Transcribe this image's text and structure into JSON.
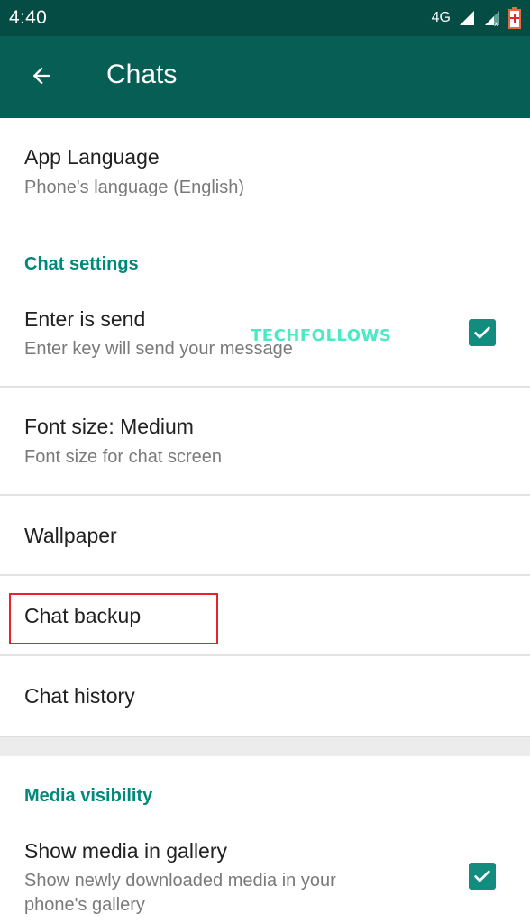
{
  "status_bar": {
    "time": "4:40",
    "network_label": "4G",
    "icons": [
      "signal-full-icon",
      "signal-no-sim-icon",
      "battery-charging-icon"
    ]
  },
  "app_bar": {
    "back_icon": "arrow-left-icon",
    "title": "Chats"
  },
  "settings": {
    "app_language": {
      "title": "App Language",
      "subtitle": "Phone's language (English)"
    },
    "chat_settings_header": "Chat settings",
    "enter_is_send": {
      "title": "Enter is send",
      "subtitle": "Enter key will send your message",
      "checked": true
    },
    "font_size": {
      "title": "Font size: Medium",
      "subtitle": "Font size for chat screen"
    },
    "wallpaper": {
      "title": "Wallpaper"
    },
    "chat_backup": {
      "title": "Chat backup",
      "highlighted": true
    },
    "chat_history": {
      "title": "Chat history"
    },
    "media_visibility_header": "Media visibility",
    "show_media": {
      "title": "Show media in gallery",
      "subtitle_line1": "Show newly downloaded media in your",
      "subtitle_line2": "phone's gallery",
      "checked": true
    }
  },
  "watermark": "TECHFOLLOWS",
  "colors": {
    "status_bar": "#054d44",
    "app_bar": "#075e54",
    "accent": "#128c7e",
    "section_header": "#00897b",
    "highlight": "#e8222e"
  }
}
